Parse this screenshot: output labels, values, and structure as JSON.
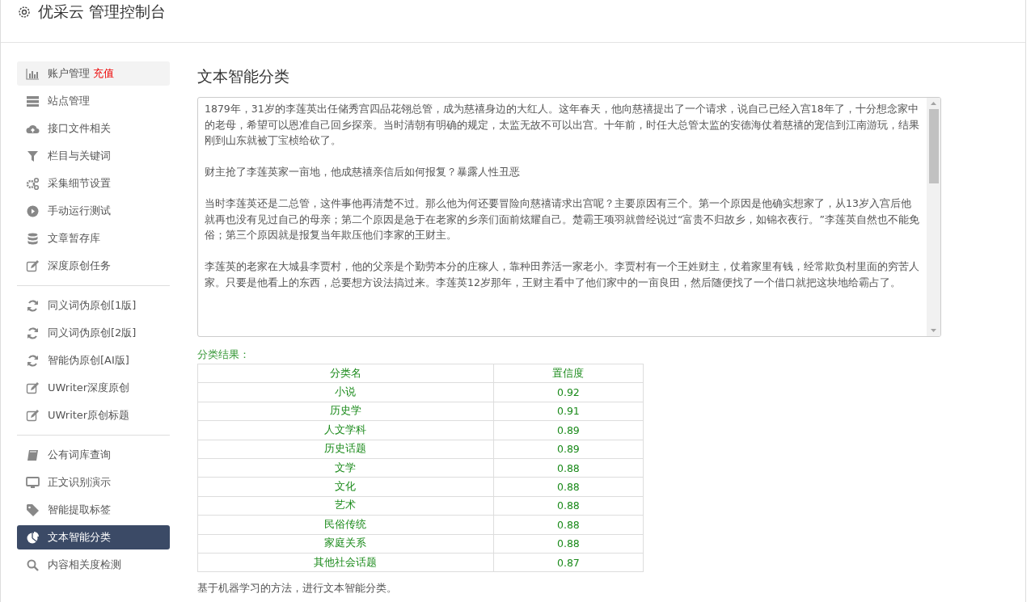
{
  "header": {
    "title": "优采云 管理控制台"
  },
  "sidebar": {
    "groups": [
      {
        "items": [
          {
            "label": "账户管理",
            "badge": "充值",
            "highlighted": true,
            "selected": false
          },
          {
            "label": "站点管理",
            "highlighted": false,
            "selected": false
          },
          {
            "label": "接口文件相关",
            "highlighted": false,
            "selected": false
          },
          {
            "label": "栏目与关键词",
            "highlighted": false,
            "selected": false
          },
          {
            "label": "采集细节设置",
            "highlighted": false,
            "selected": false
          },
          {
            "label": "手动运行测试",
            "highlighted": false,
            "selected": false
          },
          {
            "label": "文章暂存库",
            "highlighted": false,
            "selected": false
          },
          {
            "label": "深度原创任务",
            "highlighted": false,
            "selected": false
          }
        ]
      },
      {
        "items": [
          {
            "label": "同义词伪原创[1版]",
            "highlighted": false,
            "selected": false
          },
          {
            "label": "同义词伪原创[2版]",
            "highlighted": false,
            "selected": false
          },
          {
            "label": "智能伪原创[AI版]",
            "highlighted": false,
            "selected": false
          },
          {
            "label": "UWriter深度原创",
            "highlighted": false,
            "selected": false
          },
          {
            "label": "UWriter原创标题",
            "highlighted": false,
            "selected": false
          }
        ]
      },
      {
        "items": [
          {
            "label": "公有词库查询",
            "highlighted": false,
            "selected": false
          },
          {
            "label": "正文识别演示",
            "highlighted": false,
            "selected": false
          },
          {
            "label": "智能提取标签",
            "highlighted": false,
            "selected": false
          },
          {
            "label": "文本智能分类",
            "highlighted": false,
            "selected": true
          },
          {
            "label": "内容相关度检测",
            "highlighted": false,
            "selected": false
          }
        ]
      }
    ]
  },
  "main": {
    "title": "文本智能分类",
    "input_text": [
      "1879年，31岁的李莲英出任储秀宫四品花翎总管，成为慈禧身边的大红人。这年春天，他向慈禧提出了一个请求，说自己已经入宫18年了，十分想念家中的老母，希望可以恩准自己回乡探亲。当时清朝有明确的规定，太监无故不可以出宫。十年前，时任大总管太监的安德海仗着慈禧的宠信到江南游玩，结果刚到山东就被丁宝桢给砍了。",
      "财主抢了李莲英家一亩地，他成慈禧亲信后如何报复？暴露人性丑恶",
      "当时李莲英还是二总管，这件事他再清楚不过。那么他为何还要冒险向慈禧请求出宫呢？主要原因有三个。第一个原因是他确实想家了，从13岁入宫后他就再也没有见过自己的母亲；第二个原因是急于在老家的乡亲们面前炫耀自己。楚霸王项羽就曾经说过“富贵不归故乡，如锦衣夜行。”李莲英自然也不能免俗；第三个原因就是报复当年欺压他们李家的王财主。",
      "李莲英的老家在大城县李贾村，他的父亲是个勤劳本分的庄稼人，靠种田养活一家老小。李贾村有一个王姓财主，仗着家里有钱，经常欺负村里面的穷苦人家。只要是他看上的东西，总要想方设法搞过来。李莲英12岁那年，王财主看中了他们家中的一亩良田，然后随便找了一个借口就把这块地给霸占了。"
    ],
    "result_label": "分类结果：",
    "table": {
      "columns": [
        "分类名",
        "置信度"
      ],
      "rows": [
        [
          "小说",
          "0.92"
        ],
        [
          "历史学",
          "0.91"
        ],
        [
          "人文学科",
          "0.89"
        ],
        [
          "历史话题",
          "0.89"
        ],
        [
          "文学",
          "0.88"
        ],
        [
          "文化",
          "0.88"
        ],
        [
          "艺术",
          "0.88"
        ],
        [
          "民俗传统",
          "0.88"
        ],
        [
          "家庭关系",
          "0.88"
        ],
        [
          "其他社会话题",
          "0.87"
        ]
      ]
    },
    "note": "基于机器学习的方法，进行文本智能分类。"
  }
}
